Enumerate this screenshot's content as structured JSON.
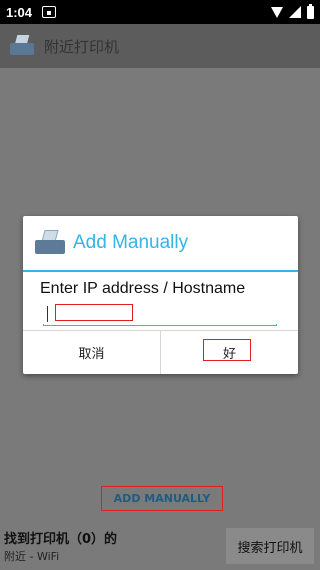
{
  "status_bar": {
    "time": "1:04",
    "notification_icon": "sim-card-icon",
    "wifi_icon": "wifi-icon",
    "signal_icon": "signal-icon",
    "battery_icon": "battery-icon"
  },
  "app_bar": {
    "title": "附近打印机",
    "logo_icon": "printer-icon"
  },
  "dialog": {
    "title": "Add Manually",
    "icon": "printer-icon",
    "label": "Enter IP address / Hostname",
    "input_value": "",
    "cancel_label": "取消",
    "ok_label": "好",
    "accent_color": "#33b5e5"
  },
  "bottom": {
    "add_manually_label": "ADD MANUALLY",
    "found_text": "找到打印机（0）的",
    "nearby_text": "附近 - WiFi",
    "search_button_label": "搜索打印机"
  },
  "colors": {
    "highlight_box": "#e02020",
    "link_color": "#1f5c82"
  }
}
